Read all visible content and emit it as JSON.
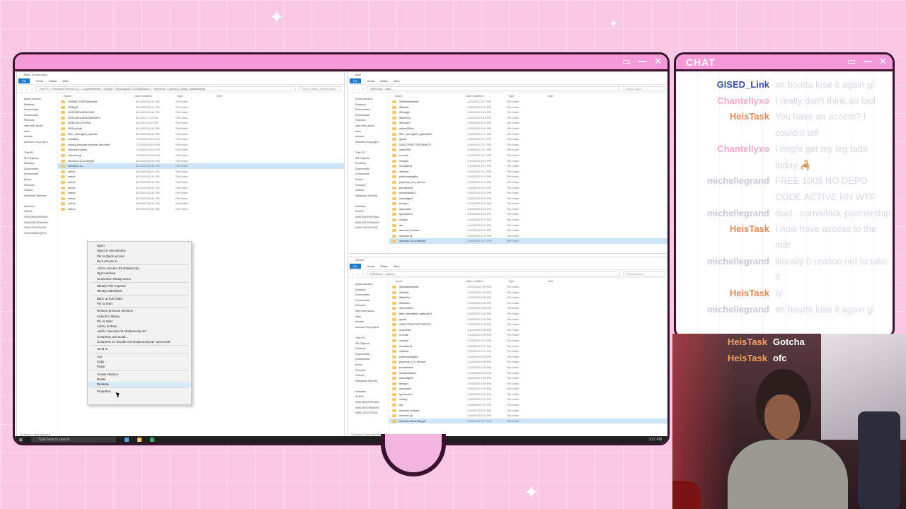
{
  "chat": {
    "title": "CHAT",
    "messages": [
      {
        "user": "GISED_Link",
        "color": "#3a4fa8",
        "text": "im boutta lose it again gl"
      },
      {
        "user": "Chantellyxo",
        "color": "#f3a6cf",
        "text": "I really don't think so lool"
      },
      {
        "user": "HeisTask",
        "color": "#e58a55",
        "text": "You have an accent? I couldnt tell"
      },
      {
        "user": "Chantellyxo",
        "color": "#f3a6cf",
        "text": "I might get my leg tatts today 🦂"
      },
      {
        "user": "michellegrand",
        "color": "#c7c7dc",
        "text": "FREE 100$ NO DEPO CODE ACTIVE RN WTF"
      },
      {
        "user": "michellegrand",
        "color": "#c7c7dc",
        "text": "duel . com/r/kick-partnership"
      },
      {
        "user": "HeisTask",
        "color": "#e58a55",
        "text": "I now have access to the mdt"
      },
      {
        "user": "michellegrand",
        "color": "#c7c7dc",
        "text": "literally 0 reason not to take it"
      },
      {
        "user": "HeisTask",
        "color": "#e58a55",
        "text": "ty"
      },
      {
        "user": "michellegrand",
        "color": "#c7c7dc",
        "text": "im boutta lose it again gl"
      }
    ],
    "overlay": [
      {
        "user": "HeisTask",
        "text": "Gotcha"
      },
      {
        "user": "HeisTask",
        "text": "ofc"
      }
    ]
  },
  "explorer_left": {
    "title": "Bliss_ShadersApp",
    "tabs": [
      "File",
      "Home",
      "Share",
      "View"
    ],
    "path": "This PC > Windows Secrets (C:) > LoganAllen3th > loBabs > ModLegacy_DCSMANcare > resources > [mods] > [Bliss_ShadersApp]",
    "search": "Search [Bliss_ShadersApp]",
    "columns": [
      "Name",
      "Date modified",
      "Type",
      "Size"
    ],
    "nav": [
      "Quick access",
      "Desktop",
      "Documents",
      "Downloads",
      "Pictures",
      "cars with audio",
      "data",
      "stream",
      "wrecker-h3-project",
      "",
      "This PC",
      "3D Objects",
      "Desktop",
      "Documents",
      "Downloads",
      "Music",
      "Pictures",
      "Videos",
      "Windows Secrets",
      "",
      "Network",
      "ALIEN",
      "WIN-0HKK0P04A0",
      "WIN-000CR5A0H0",
      "WIN-C0C07H10E",
      "WIN-0M0A1QP1V"
    ],
    "rows": [
      {
        "name": "DWNM-100RTswitched",
        "date": "8/10/2023 6:11 PM",
        "type": "File folder"
      },
      {
        "name": "DRNgIT",
        "date": "8/10/2023 6:11 PM",
        "type": "File folder"
      },
      {
        "name": "DSSODELAENGINE",
        "date": "8/10/2023 6:11 PM",
        "type": "File folder"
      },
      {
        "name": "DSSODELAENGNEINNT",
        "date": "8/1/2023 7:22 PM",
        "type": "File folder"
      },
      {
        "name": "DSSODELTERRA",
        "date": "8/1/2023 5:52 PM",
        "type": "File folder"
      },
      {
        "name": "DSSrcKulls",
        "date": "8/10/2023 6:11 PM",
        "type": "File folder"
      },
      {
        "name": "fiber_strenghth_special",
        "date": "8/10/2023 6:11 PM",
        "type": "File folder"
      },
      {
        "name": "resellers",
        "date": "7/10/2023 5:04 PM",
        "type": "File folder"
      },
      {
        "name": "victory-chopper-wrecker-decoded",
        "date": "7/10/2023 5:04 PM",
        "type": "File folder"
      },
      {
        "name": "wrecker-chains",
        "date": "7/10/2023 6:04 PM",
        "type": "File folder"
      },
      {
        "name": "wrecker-gl",
        "date": "7/10/2023 5:04 PM",
        "type": "File folder"
      },
      {
        "name": "wrecker-h3-undergrd",
        "date": "8/10/2023 6:11 PM",
        "type": "File folder"
      },
      {
        "name": "wrecker-h3-...",
        "date": "8/10/2023 6:11 PM",
        "type": "File folder"
      },
      {
        "name": "wreck",
        "date": "8/10/2023 6:11 PM",
        "type": "File folder"
      },
      {
        "name": "wreck",
        "date": "8/10/2023 6:11 PM",
        "type": "File folder"
      },
      {
        "name": "wreck",
        "date": "8/10/2023 6:11 PM",
        "type": "File folder"
      },
      {
        "name": "wreck",
        "date": "8/10/2023 6:11 PM",
        "type": "File folder"
      },
      {
        "name": "wreck",
        "date": "8/10/2023 6:11 PM",
        "type": "File folder"
      },
      {
        "name": "wreck",
        "date": "8/10/2023 6:11 PM",
        "type": "File folder"
      },
      {
        "name": "wreck",
        "date": "8/10/2023 6:11 PM",
        "type": "File folder"
      },
      {
        "name": "wreck",
        "date": "8/10/2023 6:11 PM",
        "type": "File folder"
      }
    ],
    "status": "21 items    1 item selected"
  },
  "context_menu": [
    "Open",
    "Open in new window",
    "Pin to Quick access",
    "Give access to",
    "-",
    "Add to wrecker-h3-shaders.zip",
    "Open archive",
    "Customise WinZip menu",
    "-",
    "WinZip PDF Express",
    "WinZip SafeShare",
    "-",
    "Back up this folder",
    "Pin to Start",
    "-",
    "Restore previous versions",
    "Include in library",
    "Pin to Start",
    "Add to archive...",
    "Add to \"wrecker-h3-shadersonly.rar\"",
    "Compress and email...",
    "Compress to \"wrecker-h3-shadersonly.rar\" and email",
    "-",
    "Send to",
    "-",
    "Cut",
    "Copy",
    "Paste",
    "-",
    "Create shortcut",
    "Delete",
    "Rename",
    "-",
    "Properties"
  ],
  "explorer_right_top": {
    "title": "data",
    "tabs": [
      "File",
      "Home",
      "Share",
      "View"
    ],
    "path": "FRMCars > data",
    "search": "Search data",
    "columns": [
      "Name",
      "Date modified",
      "Type",
      "Size"
    ],
    "nav": [
      "Quick access",
      "Desktop",
      "Documents",
      "Downloads",
      "Pictures",
      "cars with audio",
      "data",
      "stream",
      "wrecker-h3-project",
      "",
      "This PC",
      "3D Objects",
      "Desktop",
      "Documents",
      "Downloads",
      "Music",
      "Pictures",
      "Videos",
      "Windows Secrets",
      "",
      "Network",
      "ALIEN",
      "WIN-0HKK0P04A0",
      "WIN-000CR5A0H0",
      "WIN-C0C07H10E"
    ],
    "rows": [
      {
        "name": "0Beetlewrecker",
        "date": "1/10/2023 2:47 PM",
        "type": "File folder"
      },
      {
        "name": "0Beetle",
        "date": "1/10/2023 2:46 PM",
        "type": "File folder"
      },
      {
        "name": "0Beagle",
        "date": "1/10/2023 2:46 PM",
        "type": "File folder"
      },
      {
        "name": "0BeefGo",
        "date": "1/10/2023 2:46 PM",
        "type": "File folder"
      },
      {
        "name": "0Bruiser",
        "date": "1/10/2023 3:01 PM",
        "type": "File folder"
      },
      {
        "name": "axiom300m",
        "date": "1/10/2023 3:01 PM",
        "type": "File folder"
      },
      {
        "name": "fiber_strenghth_special03",
        "date": "1/10/2023 2:47 PM",
        "type": "File folder"
      },
      {
        "name": "guard",
        "date": "1/10/2023 2:47 PM",
        "type": "File folder"
      },
      {
        "name": "G6DXTRACTESTANKTV",
        "date": "1/10/2023 2:47 PM",
        "type": "File folder"
      },
      {
        "name": "mav200h",
        "date": "1/10/2023 2:47 PM",
        "type": "File folder"
      },
      {
        "name": "ic-code",
        "date": "1/10/2023 2:47 PM",
        "type": "File folder"
      },
      {
        "name": "maxgirl",
        "date": "1/10/2023 3:01 PM",
        "type": "File folder"
      },
      {
        "name": "monstercil",
        "date": "1/10/2023 2:47 PM",
        "type": "File folder"
      },
      {
        "name": "mtlboid",
        "date": "1/10/2023 2:47 PM",
        "type": "File folder"
      },
      {
        "name": "philbrockinglity",
        "date": "1/10/2023 3:01 PM",
        "type": "File folder"
      },
      {
        "name": "psychos_r14_demon",
        "date": "1/10/2023 3:01 PM",
        "type": "File folder"
      },
      {
        "name": "pendlemwt",
        "date": "1/10/2023 3:01 PM",
        "type": "File folder"
      },
      {
        "name": "smashbulk02",
        "date": "1/10/2023 3:01 PM",
        "type": "File folder"
      },
      {
        "name": "sinoddget2",
        "date": "1/10/2023 3:01 PM",
        "type": "File folder"
      },
      {
        "name": "tempo1",
        "date": "1/10/2023 3:01 PM",
        "type": "File folder"
      },
      {
        "name": "simutown",
        "date": "1/10/2023 3:01 PM",
        "type": "File folder"
      },
      {
        "name": "sportsmen",
        "date": "1/10/2023 3:01 PM",
        "type": "File folder"
      },
      {
        "name": "victory",
        "date": "1/10/2023 3:01 PM",
        "type": "File folder"
      },
      {
        "name": "aw",
        "date": "1/10/2023 3:01 PM",
        "type": "File folder"
      },
      {
        "name": "wrecker-chassis",
        "date": "1/10/2023 3:01 PM",
        "type": "File folder"
      },
      {
        "name": "wrecker-gl",
        "date": "1/10/2023 3:01 PM",
        "type": "File folder"
      },
      {
        "name": "wrecker-h3-undergrd",
        "date": "1/10/2023 3:27 PM",
        "type": "File folder"
      }
    ]
  },
  "explorer_right_bottom": {
    "title": "stream",
    "tabs": [
      "File",
      "Home",
      "Share",
      "View"
    ],
    "path": "FRMCars > stream",
    "search": "Search stream",
    "columns": [
      "Name",
      "Date modified",
      "Type",
      "Size"
    ],
    "nav": [
      "Quick access",
      "Desktop",
      "Documents",
      "Downloads",
      "Pictures",
      "cars with audio",
      "data",
      "stream",
      "wrecker-h3-project",
      "",
      "This PC",
      "3D Objects",
      "Desktop",
      "Documents",
      "Downloads",
      "Music",
      "Pictures",
      "Videos",
      "Windows Secrets",
      "",
      "Network",
      "ALIEN",
      "WIN-0HKK0P04A0",
      "WIN-000CR5A0H0",
      "WIN-C0C07H10E"
    ],
    "rows": [
      {
        "name": "0Beetlewrecker",
        "date": "1/10/2023 2:56 PM",
        "type": "File folder"
      },
      {
        "name": "0Beetle",
        "date": "1/10/2023 2:56 PM",
        "type": "File folder"
      },
      {
        "name": "0BeefGo",
        "date": "1/10/2023 2:56 PM",
        "type": "File folder"
      },
      {
        "name": "0Bruiser",
        "date": "1/10/2023 2:56 PM",
        "type": "File folder"
      },
      {
        "name": "axiom300m",
        "date": "1/10/2023 2:56 PM",
        "type": "File folder"
      },
      {
        "name": "fiber_strenghth_special03",
        "date": "1/10/2023 2:56 PM",
        "type": "File folder"
      },
      {
        "name": "guard",
        "date": "1/10/2023 2:56 PM",
        "type": "File folder"
      },
      {
        "name": "G6DXTRACTESTANKTV",
        "date": "1/10/2023 2:56 PM",
        "type": "File folder"
      },
      {
        "name": "mav200h",
        "date": "1/10/2023 2:56 PM",
        "type": "File folder"
      },
      {
        "name": "ic-code",
        "date": "1/10/2023 2:56 PM",
        "type": "File folder"
      },
      {
        "name": "maxgirl",
        "date": "1/10/2023 2:57 PM",
        "type": "File folder"
      },
      {
        "name": "monstercil",
        "date": "1/10/2023 2:57 PM",
        "type": "File folder"
      },
      {
        "name": "mtlboid",
        "date": "1/10/2023 2:57 PM",
        "type": "File folder"
      },
      {
        "name": "philbrockinglity",
        "date": "1/10/2023 2:58 PM",
        "type": "File folder"
      },
      {
        "name": "psychos_r14_demon",
        "date": "1/10/2023 2:58 PM",
        "type": "File folder"
      },
      {
        "name": "pendlemwt",
        "date": "1/10/2023 2:58 PM",
        "type": "File folder"
      },
      {
        "name": "smashbulk02",
        "date": "1/10/2023 2:58 PM",
        "type": "File folder"
      },
      {
        "name": "sinoddget2",
        "date": "1/10/2023 2:58 PM",
        "type": "File folder"
      },
      {
        "name": "tempo1",
        "date": "1/10/2023 2:58 PM",
        "type": "File folder"
      },
      {
        "name": "simutown",
        "date": "1/10/2023 2:59 PM",
        "type": "File folder"
      },
      {
        "name": "sportsmen",
        "date": "1/10/2023 2:59 PM",
        "type": "File folder"
      },
      {
        "name": "victory",
        "date": "1/10/2023 2:59 PM",
        "type": "File folder"
      },
      {
        "name": "aw",
        "date": "1/10/2023 2:59 PM",
        "type": "File folder"
      },
      {
        "name": "wrecker-chassis",
        "date": "1/10/2023 3:01 PM",
        "type": "File folder"
      },
      {
        "name": "wrecker-gl",
        "date": "1/10/2023 3:01 PM",
        "type": "File folder"
      },
      {
        "name": "wrecker-h3-undergrd",
        "date": "1/10/2023 3:27 PM",
        "type": "File folder"
      }
    ],
    "status": "26 items    1 item selected"
  },
  "taskbar": {
    "search": "Type here to search",
    "clock": "3:27 PM"
  },
  "window_controls": [
    "▭",
    "—",
    "✕"
  ],
  "colors": {
    "background": "#f8c8e4",
    "frame_bar": "#f49ad8",
    "frame_border": "#3a1230",
    "accent_user": "#e58a55"
  }
}
